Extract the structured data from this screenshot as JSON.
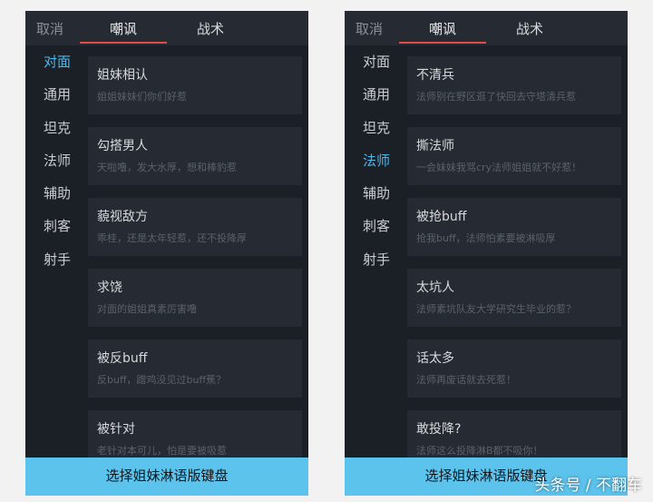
{
  "left": {
    "cancel_label": "取消",
    "tabs": [
      {
        "label": "嘲讽"
      },
      {
        "label": "战术"
      }
    ],
    "categories": [
      {
        "label": "对面",
        "active": true
      },
      {
        "label": "通用"
      },
      {
        "label": "坦克"
      },
      {
        "label": "法师"
      },
      {
        "label": "辅助"
      },
      {
        "label": "刺客"
      },
      {
        "label": "射手"
      }
    ],
    "items": [
      {
        "title": "姐妹相认",
        "subtitle": "姐姐妹妹们你们好惹"
      },
      {
        "title": "勾搭男人",
        "subtitle": "天啦噜，发大水厚，想和棒豹惹"
      },
      {
        "title": "藐视敌方",
        "subtitle": "乖桂，还是太年轻惹，还不投降厚"
      },
      {
        "title": "求饶",
        "subtitle": "对面的姐姐真素厉害噜"
      },
      {
        "title": "被反buff",
        "subtitle": "反buff，蹭鸡没见过buff蕉？"
      },
      {
        "title": "被针对",
        "subtitle": "老针对本可儿，怕是要被吸惹"
      }
    ],
    "bottom_label": "选择姐妹淋语版键盘"
  },
  "right": {
    "cancel_label": "取消",
    "tabs": [
      {
        "label": "嘲讽"
      },
      {
        "label": "战术"
      }
    ],
    "categories": [
      {
        "label": "对面"
      },
      {
        "label": "通用"
      },
      {
        "label": "坦克"
      },
      {
        "label": "法师",
        "active": true
      },
      {
        "label": "辅助"
      },
      {
        "label": "刺客"
      },
      {
        "label": "射手"
      }
    ],
    "items": [
      {
        "title": "不清兵",
        "subtitle": "法师别在野区逛了快回去守塔清兵惹"
      },
      {
        "title": "撕法师",
        "subtitle": "一会妹妹我骂cry法师姐姐就不好惹！"
      },
      {
        "title": "被抢buff",
        "subtitle": "抢我buff，法师怕素要被淋吸厚"
      },
      {
        "title": "太坑人",
        "subtitle": "法师素坑队友大学研究生毕业的惹？"
      },
      {
        "title": "话太多",
        "subtitle": "法师再废话就去死惹！"
      },
      {
        "title": "敢投降?",
        "subtitle": "法师这么投降淋B都不吸你！"
      }
    ],
    "bottom_label": "选择姐妹淋语版键盘"
  },
  "watermark": "头条号 / 不翻车",
  "colors": {
    "background": "#1b1f26",
    "card": "#262b33",
    "accent_tab_underline": "#e24c44",
    "active_category": "#4fb7ea",
    "bottom_bar": "#5cc3ec"
  }
}
